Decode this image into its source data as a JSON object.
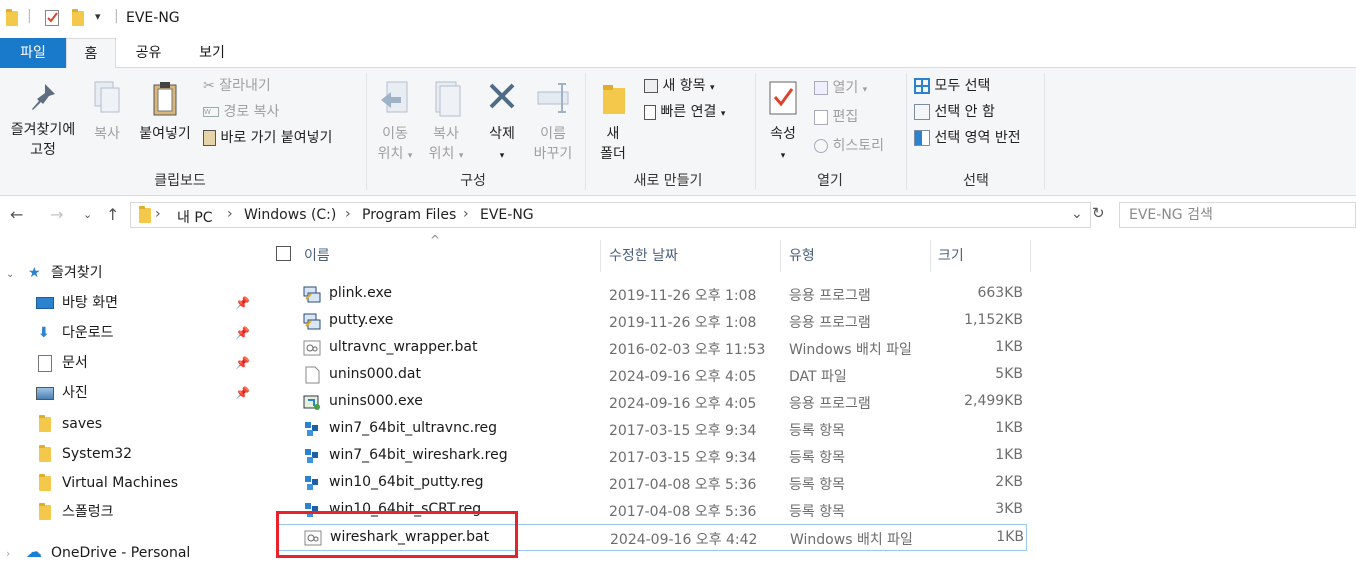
{
  "window": {
    "title": "EVE-NG"
  },
  "ribbon_tabs": [
    "파일",
    "홈",
    "공유",
    "보기"
  ],
  "ribbon": {
    "clipboard": {
      "pin_label_1": "즐겨찾기에",
      "pin_label_2": "고정",
      "copy": "복사",
      "paste": "붙여넣기",
      "cut": "잘라내기",
      "copy_path": "경로 복사",
      "paste_shortcut": "바로 가기 붙여넣기",
      "group": "클립보드"
    },
    "organize": {
      "move_1": "이동",
      "move_2": "위치",
      "copyto_1": "복사",
      "copyto_2": "위치",
      "delete": "삭제",
      "rename_1": "이름",
      "rename_2": "바꾸기",
      "group": "구성"
    },
    "new": {
      "new_folder_1": "새",
      "new_folder_2": "폴더",
      "new_item": "새 항목",
      "easy_access": "빠른 연결",
      "group": "새로 만들기"
    },
    "open": {
      "properties": "속성",
      "open": "열기",
      "edit": "편집",
      "history": "히스토리",
      "group": "열기"
    },
    "select": {
      "select_all": "모두 선택",
      "select_none": "선택 안 함",
      "invert": "선택 영역 반전",
      "group": "선택"
    }
  },
  "breadcrumb": [
    "내 PC",
    "Windows (C:)",
    "Program Files",
    "EVE-NG"
  ],
  "search": {
    "placeholder": "EVE-NG 검색"
  },
  "nav": {
    "quick_access": "즐겨찾기",
    "items": [
      "바탕 화면",
      "다운로드",
      "문서",
      "사진",
      "saves",
      "System32",
      "Virtual Machines",
      "스폴렁크"
    ],
    "onedrive": "OneDrive - Personal"
  },
  "columns": {
    "name": "이름",
    "date": "수정한 날짜",
    "type": "유형",
    "size": "크기"
  },
  "files": [
    {
      "name": "plink.exe",
      "date": "2019-11-26 오후 1:08",
      "type": "응용 프로그램",
      "size": "663KB",
      "icon": "putty-icon"
    },
    {
      "name": "putty.exe",
      "date": "2019-11-26 오후 1:08",
      "type": "응용 프로그램",
      "size": "1,152KB",
      "icon": "putty-icon"
    },
    {
      "name": "ultravnc_wrapper.bat",
      "date": "2016-02-03 오후 11:53",
      "type": "Windows 배치 파일",
      "size": "1KB",
      "icon": "batch-file-icon"
    },
    {
      "name": "unins000.dat",
      "date": "2024-09-16 오후 4:05",
      "type": "DAT 파일",
      "size": "5KB",
      "icon": "blank-file-icon"
    },
    {
      "name": "unins000.exe",
      "date": "2024-09-16 오후 4:05",
      "type": "응용 프로그램",
      "size": "2,499KB",
      "icon": "installer-icon"
    },
    {
      "name": "win7_64bit_ultravnc.reg",
      "date": "2017-03-15 오후 9:34",
      "type": "등록 항목",
      "size": "1KB",
      "icon": "registry-file-icon"
    },
    {
      "name": "win7_64bit_wireshark.reg",
      "date": "2017-03-15 오후 9:34",
      "type": "등록 항목",
      "size": "1KB",
      "icon": "registry-file-icon"
    },
    {
      "name": "win10_64bit_putty.reg",
      "date": "2017-04-08 오후 5:36",
      "type": "등록 항목",
      "size": "2KB",
      "icon": "registry-file-icon"
    },
    {
      "name": "win10_64bit_sCRT.reg",
      "date": "2017-04-08 오후 5:36",
      "type": "등록 항목",
      "size": "3KB",
      "icon": "registry-file-icon"
    },
    {
      "name": "wireshark_wrapper.bat",
      "date": "2024-09-16 오후 4:42",
      "type": "Windows 배치 파일",
      "size": "1KB",
      "icon": "batch-file-icon"
    }
  ],
  "colors": {
    "accent": "#1979ca",
    "highlight_box": "#e8212a",
    "folder": "#f3c84b"
  }
}
